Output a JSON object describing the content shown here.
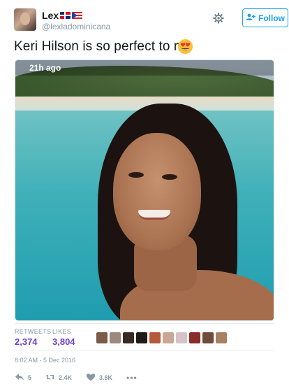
{
  "user": {
    "display_name": "Lex",
    "handle": "@lexladominicana"
  },
  "follow_label": "Follow",
  "tweet": {
    "text": "Keri Hilson is so perfect to me",
    "emoji": "heart-eyes-emoji"
  },
  "media": {
    "snap_time": "21h ago"
  },
  "stats": {
    "retweets_label": "RETWEETS",
    "retweets_value": "2,374",
    "likes_label": "LIKES",
    "likes_value": "3,804"
  },
  "timestamp": "8:02 AM - 5 Dec 2016",
  "actions": {
    "reply_count": "5",
    "retweet_count": "2.4K",
    "like_count": "3.8K",
    "more": "•••"
  },
  "colors": {
    "accent": "#1da1f2",
    "stat_value": "#6b3fd1",
    "muted": "#8899a6"
  }
}
